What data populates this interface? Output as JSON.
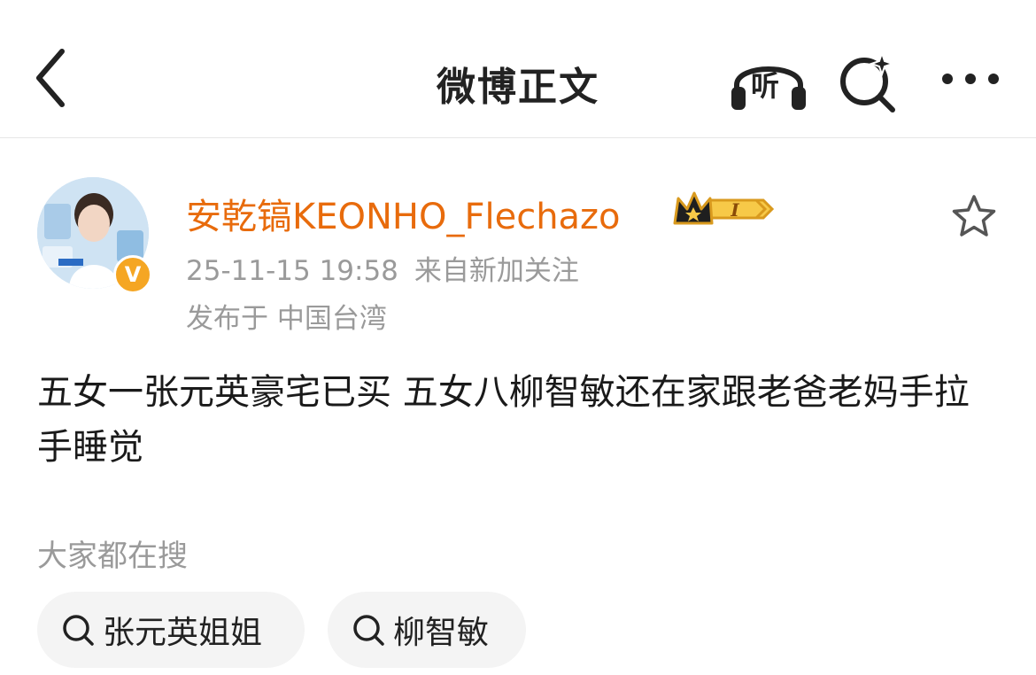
{
  "header": {
    "title": "微博正文",
    "listen_label": "听"
  },
  "post": {
    "author": "安乾镐KEONHO_Flechazo",
    "vip_level": "I",
    "verified_mark": "V",
    "timestamp": "25-11-15 19:58",
    "source": "来自新加关注",
    "location": "发布于 中国台湾",
    "text": "五女一张元英豪宅已买 五女八柳智敏还在家跟老爸老妈手拉手睡觉"
  },
  "search": {
    "heading": "大家都在搜",
    "chips": [
      {
        "label": "张元英姐姐"
      },
      {
        "label": "柳智敏"
      }
    ]
  },
  "colors": {
    "author": "#e86b0c",
    "meta": "#9a9a9a",
    "badge": "#f5a623"
  },
  "icons": [
    "back-arrow-icon",
    "headphones-icon",
    "search-sparkle-icon",
    "more-icon",
    "star-icon",
    "search-icon"
  ]
}
